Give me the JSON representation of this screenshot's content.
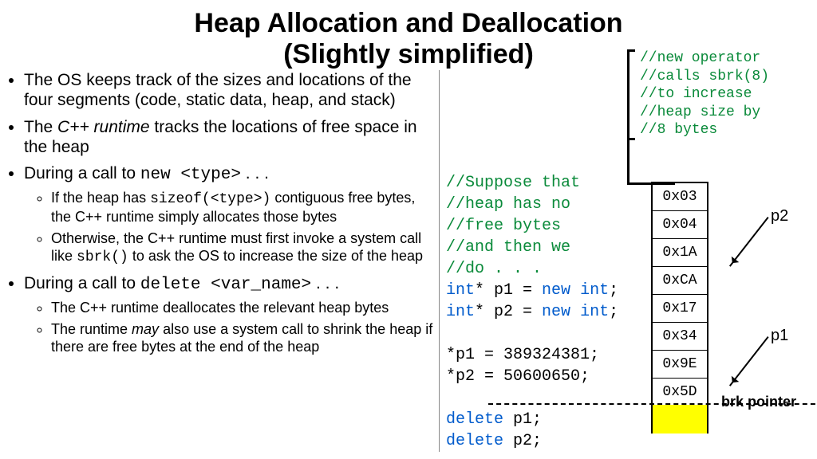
{
  "title_line1": "Heap Allocation and Deallocation",
  "title_line2": "(Slightly simplified)",
  "bullets": {
    "b1": "The OS keeps track of the sizes and locations of the four segments (code, static data, heap, and stack)",
    "b2_pre": "The ",
    "b2_em": "C++ runtime",
    "b2_post": " tracks the locations of free space in the heap",
    "b3_pre": "During a call to ",
    "b3_code": "new <type>",
    "b3_post": " . . .",
    "b3a_pre": "If the heap has ",
    "b3a_code": "sizeof(<type>)",
    "b3a_post": " contiguous free bytes, the C++ runtime simply allocates those bytes",
    "b3b_pre": "Otherwise, the C++ runtime must first invoke a system call like ",
    "b3b_code": "sbrk()",
    "b3b_post": " to ask the OS to increase the size of the heap",
    "b4_pre": "During a call to ",
    "b4_code": "delete <var_name>",
    "b4_post": " . . .",
    "b4a": "The C++ runtime deallocates the relevant heap bytes",
    "b4b_pre": "The runtime ",
    "b4b_em": "may",
    "b4b_post": " also use a system call to shrink the heap if there are free bytes at the end of the heap"
  },
  "code": {
    "c1": "//Suppose that",
    "c2": "//heap has no",
    "c3": "//free bytes",
    "c4": "//and then we",
    "c5": "//do . . .",
    "kw_int": "int",
    "kw_new": "new",
    "kw_delete": "delete",
    "star": "*",
    "p1": " p1 = ",
    "p2": " p2 = ",
    "semi_int": ";",
    "assign1": "*p1 = 389324381;",
    "assign2": "*p2 = 50600650;",
    "del1": " p1;",
    "del2": " p2;"
  },
  "annot": {
    "a1": "//new operator",
    "a2": "//calls sbrk(8)",
    "a3": "//to increase",
    "a4": "//heap size by",
    "a5": "//8 bytes"
  },
  "heap": {
    "cells": [
      "0x03",
      "0x04",
      "0x1A",
      "0xCA",
      "0x17",
      "0x34",
      "0x9E",
      "0x5D"
    ]
  },
  "labels": {
    "p1": "p1",
    "p2": "p2",
    "brk": "brk pointer"
  }
}
